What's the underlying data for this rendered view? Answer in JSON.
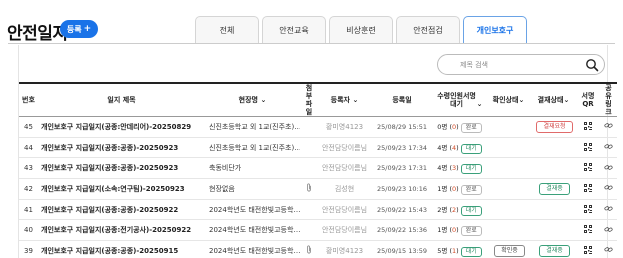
{
  "header": {
    "title": "안전일지",
    "register_label": "등록"
  },
  "tabs": [
    "전체",
    "안전교육",
    "비상훈련",
    "안전점검",
    "개인보호구"
  ],
  "search": {
    "placeholder": "제목 검색"
  },
  "table": {
    "headers": {
      "no": "번호",
      "title": "일지 제목",
      "place": "현장명",
      "attach": "첨부파일",
      "registrant": "등록자",
      "date": "등록일",
      "count": "수령인원서명대기",
      "confirm": "확인상태",
      "approval": "결재상태",
      "qr": "서명QR",
      "share": "공유링크"
    },
    "rows": [
      {
        "no": "45",
        "title": "개인보호구 지급일지(공종:안데리어)-20250829",
        "place": "신진초등학교 외 1교(진주초)…",
        "attach": false,
        "registrant": "황미영4123",
        "date": "25/08/29 15:51",
        "count": "0명",
        "wait": "0",
        "status": "완료",
        "confirm": "",
        "approval": "결재요청",
        "approval_type": "req"
      },
      {
        "no": "44",
        "title": "개인보호구 지급일지(공종:공종)-20250923",
        "place": "신진초등학교 외 1교(진주초)…",
        "attach": false,
        "registrant": "안전담당이름님",
        "date": "25/09/23 17:34",
        "count": "4명",
        "wait": "4",
        "status": "대기",
        "confirm": "",
        "approval": "",
        "approval_type": ""
      },
      {
        "no": "43",
        "title": "개인보호구 지급일지(공종:공종)-20250923",
        "place": "축동비단가",
        "attach": false,
        "registrant": "안전담당이름님",
        "date": "25/09/23 17:31",
        "count": "4명",
        "wait": "3",
        "status": "대기",
        "confirm": "",
        "approval": "",
        "approval_type": ""
      },
      {
        "no": "42",
        "title": "개인보호구 지급일지(소속:연구팀)-20250923",
        "place": "현장없음",
        "attach": true,
        "registrant": "김성현",
        "date": "25/09/23 10:16",
        "count": "1명",
        "wait": "0",
        "status": "완료",
        "confirm": "",
        "approval": "결재중",
        "approval_type": "apv"
      },
      {
        "no": "41",
        "title": "개인보호구 지급일지(공종:공종)-20250922",
        "place": "2024학년도 태전한빛고등학…",
        "attach": false,
        "registrant": "안전담당이름님",
        "date": "25/09/22 15:43",
        "count": "2명",
        "wait": "2",
        "status": "대기",
        "confirm": "",
        "approval": "",
        "approval_type": ""
      },
      {
        "no": "40",
        "title": "개인보호구 지급일지(공종:전기공사)-20250922",
        "place": "2024학년도 태전한빛고등학…",
        "attach": false,
        "registrant": "안전담당이름님",
        "date": "25/09/22 15:36",
        "count": "1명",
        "wait": "0",
        "status": "완료",
        "confirm": "",
        "approval": "",
        "approval_type": ""
      },
      {
        "no": "39",
        "title": "개인보호구 지급일지(공종:공종)-20250915",
        "place": "2024학년도 태전한빛고등학…",
        "attach": true,
        "registrant": "황미영4123",
        "date": "25/09/15 13:59",
        "count": "5명",
        "wait": "1",
        "status": "대기",
        "confirm": "확인중",
        "approval": "결재중",
        "approval_type": "apv"
      }
    ]
  },
  "colors": {
    "accent": "#1a73e8",
    "wait_green": "#2a8c63",
    "red": "#d04040"
  }
}
